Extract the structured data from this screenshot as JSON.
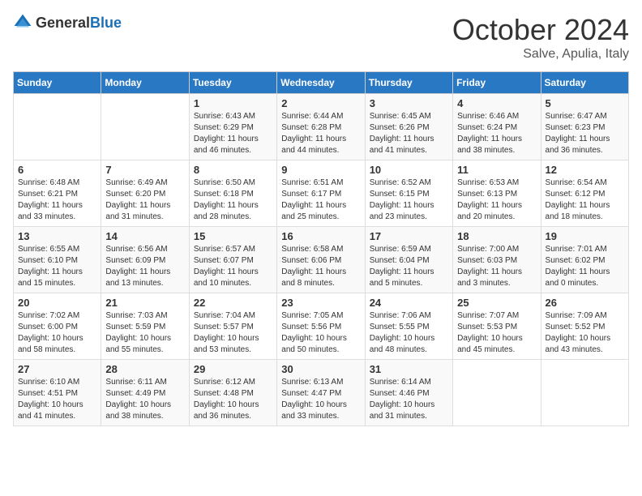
{
  "header": {
    "logo_general": "General",
    "logo_blue": "Blue",
    "month": "October 2024",
    "location": "Salve, Apulia, Italy"
  },
  "days_of_week": [
    "Sunday",
    "Monday",
    "Tuesday",
    "Wednesday",
    "Thursday",
    "Friday",
    "Saturday"
  ],
  "weeks": [
    [
      {
        "day": "",
        "content": ""
      },
      {
        "day": "",
        "content": ""
      },
      {
        "day": "1",
        "content": "Sunrise: 6:43 AM\nSunset: 6:29 PM\nDaylight: 11 hours\nand 46 minutes."
      },
      {
        "day": "2",
        "content": "Sunrise: 6:44 AM\nSunset: 6:28 PM\nDaylight: 11 hours\nand 44 minutes."
      },
      {
        "day": "3",
        "content": "Sunrise: 6:45 AM\nSunset: 6:26 PM\nDaylight: 11 hours\nand 41 minutes."
      },
      {
        "day": "4",
        "content": "Sunrise: 6:46 AM\nSunset: 6:24 PM\nDaylight: 11 hours\nand 38 minutes."
      },
      {
        "day": "5",
        "content": "Sunrise: 6:47 AM\nSunset: 6:23 PM\nDaylight: 11 hours\nand 36 minutes."
      }
    ],
    [
      {
        "day": "6",
        "content": "Sunrise: 6:48 AM\nSunset: 6:21 PM\nDaylight: 11 hours\nand 33 minutes."
      },
      {
        "day": "7",
        "content": "Sunrise: 6:49 AM\nSunset: 6:20 PM\nDaylight: 11 hours\nand 31 minutes."
      },
      {
        "day": "8",
        "content": "Sunrise: 6:50 AM\nSunset: 6:18 PM\nDaylight: 11 hours\nand 28 minutes."
      },
      {
        "day": "9",
        "content": "Sunrise: 6:51 AM\nSunset: 6:17 PM\nDaylight: 11 hours\nand 25 minutes."
      },
      {
        "day": "10",
        "content": "Sunrise: 6:52 AM\nSunset: 6:15 PM\nDaylight: 11 hours\nand 23 minutes."
      },
      {
        "day": "11",
        "content": "Sunrise: 6:53 AM\nSunset: 6:13 PM\nDaylight: 11 hours\nand 20 minutes."
      },
      {
        "day": "12",
        "content": "Sunrise: 6:54 AM\nSunset: 6:12 PM\nDaylight: 11 hours\nand 18 minutes."
      }
    ],
    [
      {
        "day": "13",
        "content": "Sunrise: 6:55 AM\nSunset: 6:10 PM\nDaylight: 11 hours\nand 15 minutes."
      },
      {
        "day": "14",
        "content": "Sunrise: 6:56 AM\nSunset: 6:09 PM\nDaylight: 11 hours\nand 13 minutes."
      },
      {
        "day": "15",
        "content": "Sunrise: 6:57 AM\nSunset: 6:07 PM\nDaylight: 11 hours\nand 10 minutes."
      },
      {
        "day": "16",
        "content": "Sunrise: 6:58 AM\nSunset: 6:06 PM\nDaylight: 11 hours\nand 8 minutes."
      },
      {
        "day": "17",
        "content": "Sunrise: 6:59 AM\nSunset: 6:04 PM\nDaylight: 11 hours\nand 5 minutes."
      },
      {
        "day": "18",
        "content": "Sunrise: 7:00 AM\nSunset: 6:03 PM\nDaylight: 11 hours\nand 3 minutes."
      },
      {
        "day": "19",
        "content": "Sunrise: 7:01 AM\nSunset: 6:02 PM\nDaylight: 11 hours\nand 0 minutes."
      }
    ],
    [
      {
        "day": "20",
        "content": "Sunrise: 7:02 AM\nSunset: 6:00 PM\nDaylight: 10 hours\nand 58 minutes."
      },
      {
        "day": "21",
        "content": "Sunrise: 7:03 AM\nSunset: 5:59 PM\nDaylight: 10 hours\nand 55 minutes."
      },
      {
        "day": "22",
        "content": "Sunrise: 7:04 AM\nSunset: 5:57 PM\nDaylight: 10 hours\nand 53 minutes."
      },
      {
        "day": "23",
        "content": "Sunrise: 7:05 AM\nSunset: 5:56 PM\nDaylight: 10 hours\nand 50 minutes."
      },
      {
        "day": "24",
        "content": "Sunrise: 7:06 AM\nSunset: 5:55 PM\nDaylight: 10 hours\nand 48 minutes."
      },
      {
        "day": "25",
        "content": "Sunrise: 7:07 AM\nSunset: 5:53 PM\nDaylight: 10 hours\nand 45 minutes."
      },
      {
        "day": "26",
        "content": "Sunrise: 7:09 AM\nSunset: 5:52 PM\nDaylight: 10 hours\nand 43 minutes."
      }
    ],
    [
      {
        "day": "27",
        "content": "Sunrise: 6:10 AM\nSunset: 4:51 PM\nDaylight: 10 hours\nand 41 minutes."
      },
      {
        "day": "28",
        "content": "Sunrise: 6:11 AM\nSunset: 4:49 PM\nDaylight: 10 hours\nand 38 minutes."
      },
      {
        "day": "29",
        "content": "Sunrise: 6:12 AM\nSunset: 4:48 PM\nDaylight: 10 hours\nand 36 minutes."
      },
      {
        "day": "30",
        "content": "Sunrise: 6:13 AM\nSunset: 4:47 PM\nDaylight: 10 hours\nand 33 minutes."
      },
      {
        "day": "31",
        "content": "Sunrise: 6:14 AM\nSunset: 4:46 PM\nDaylight: 10 hours\nand 31 minutes."
      },
      {
        "day": "",
        "content": ""
      },
      {
        "day": "",
        "content": ""
      }
    ]
  ]
}
